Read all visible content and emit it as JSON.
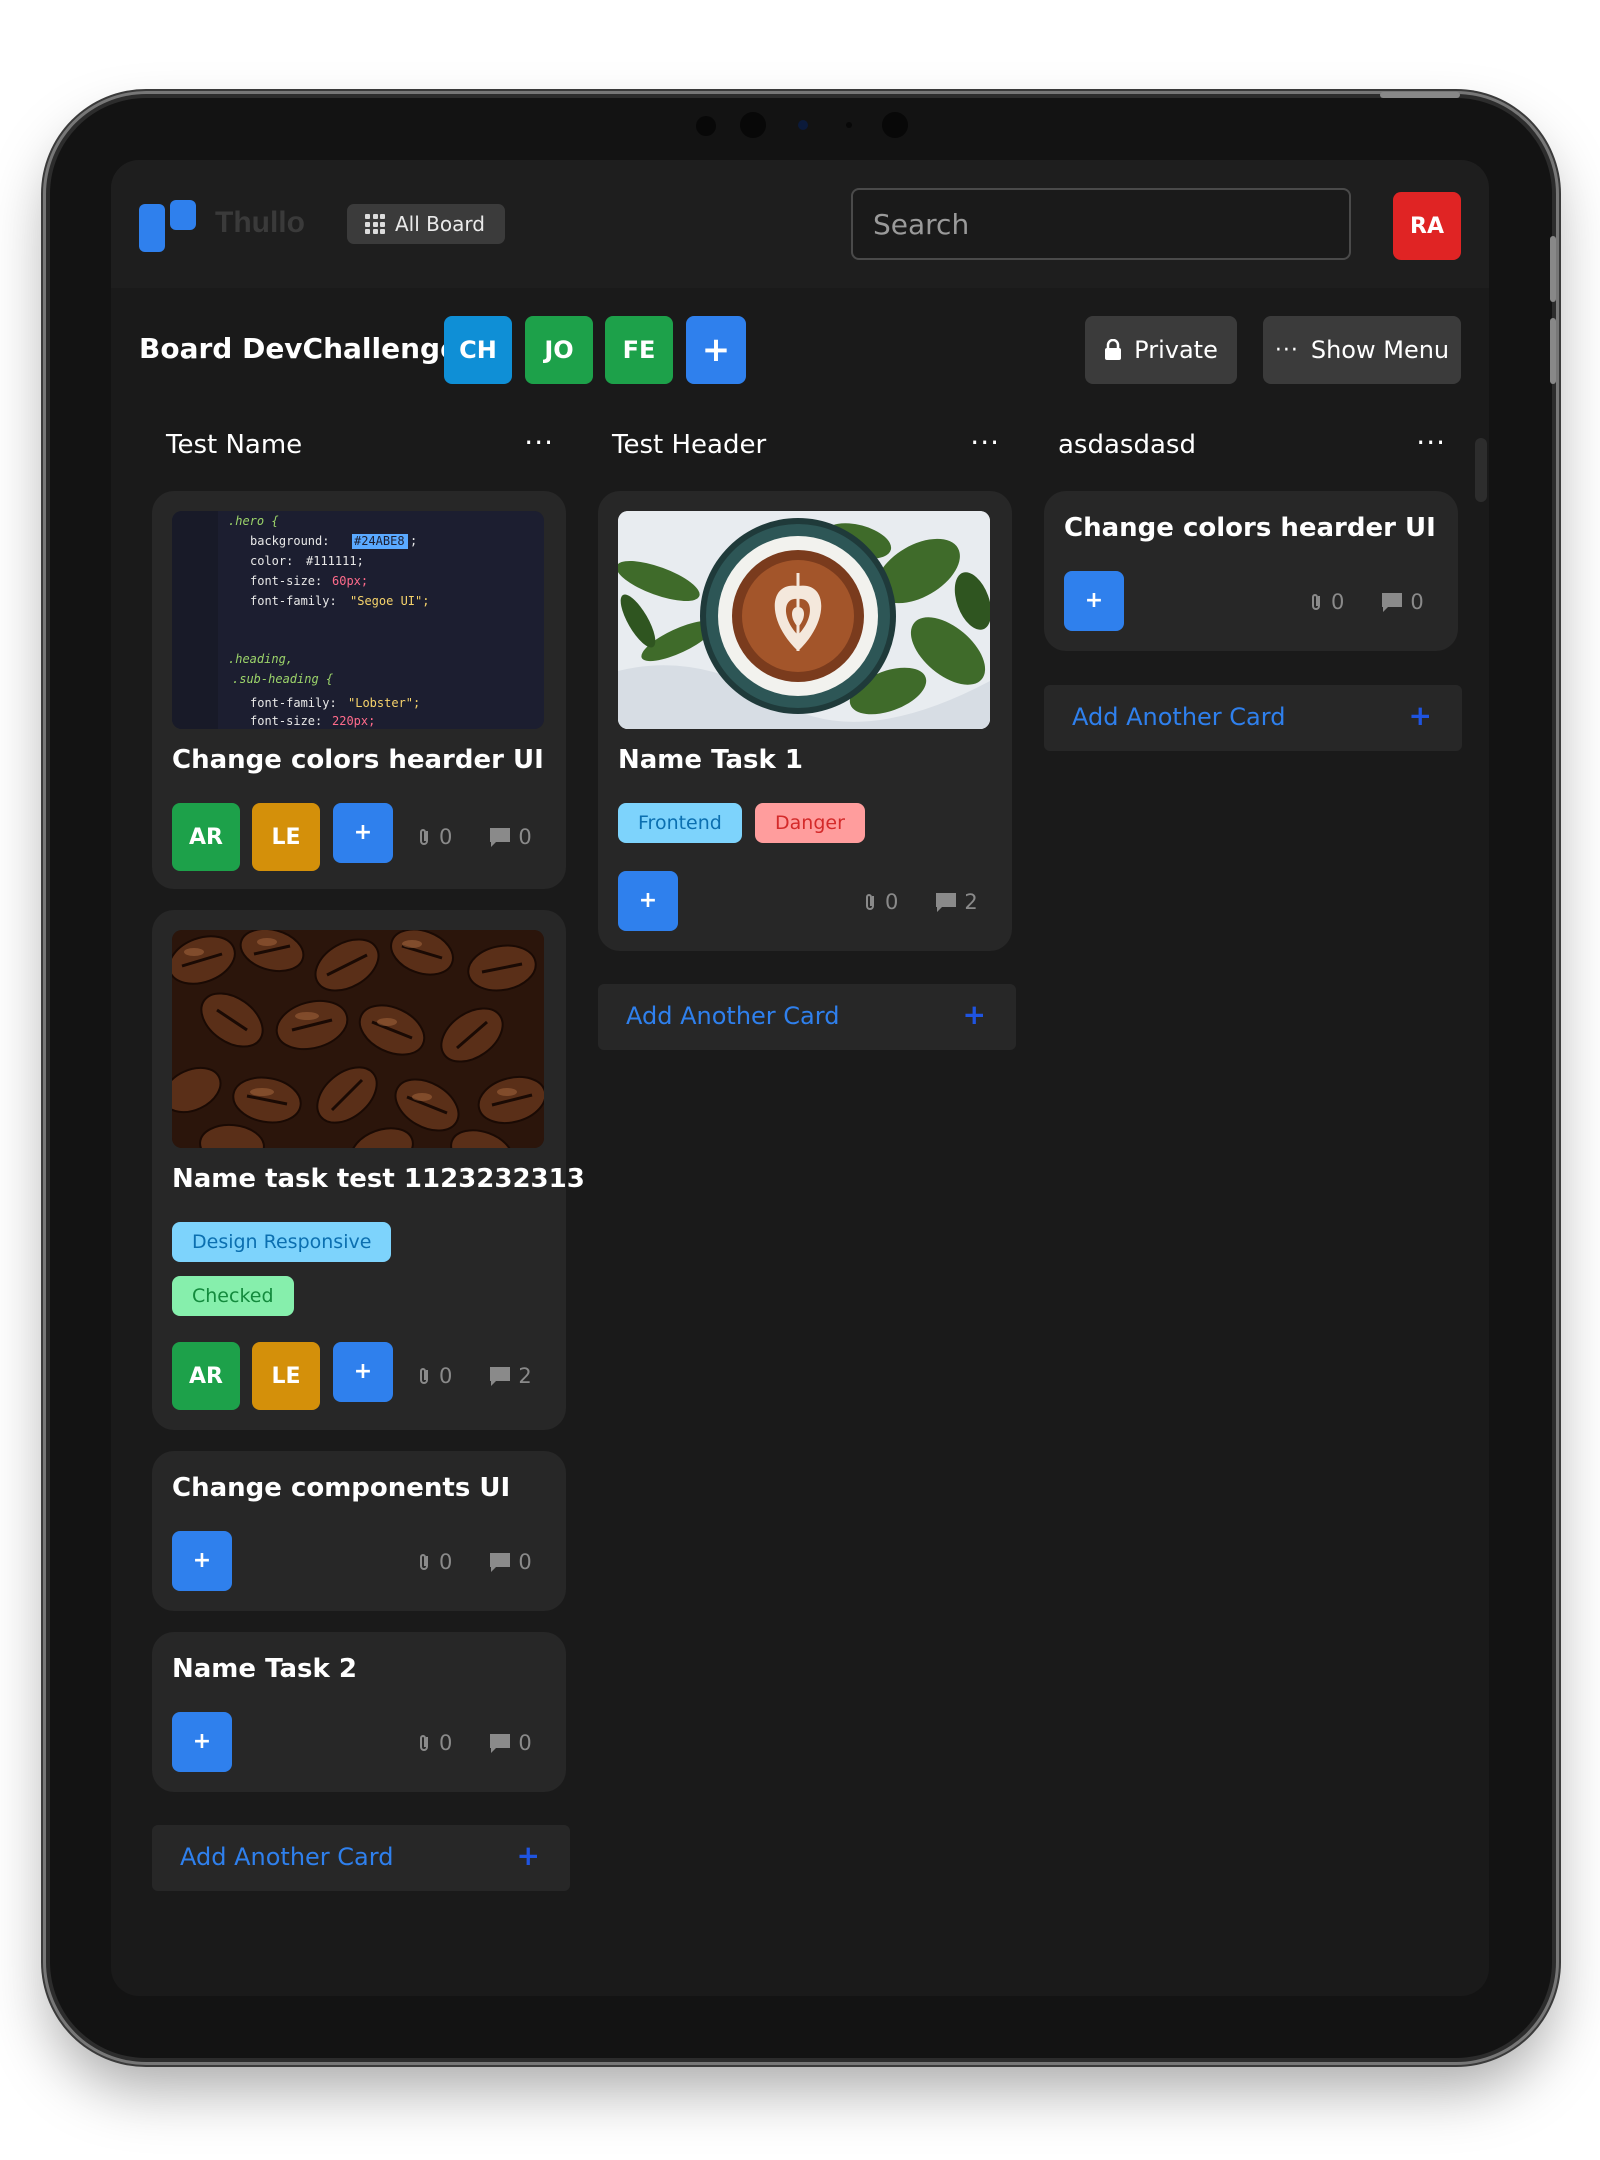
{
  "app": {
    "brand": "Thullo",
    "all_board_label": "All Board",
    "search_placeholder": "Search",
    "user_initials": "RA"
  },
  "board": {
    "title": "Board DevChallenge",
    "members": [
      {
        "initials": "CH",
        "color": "#0f8fd6"
      },
      {
        "initials": "JO",
        "color": "#1da14a"
      },
      {
        "initials": "FE",
        "color": "#1da14a"
      }
    ],
    "private_label": "Private",
    "show_menu_label": "Show Menu"
  },
  "colors": {
    "accent": "#2f80ed",
    "card": "#272727",
    "danger_tag_bg": "#ff9d9d",
    "frontend_tag_bg": "#7dd3fc",
    "checked_tag_bg": "#86efac"
  },
  "add_card_label": "Add Another Card",
  "columns": [
    {
      "title": "Test Name",
      "cards": [
        {
          "title": "Change colors hearder UI",
          "image": "code-snippet",
          "members": [
            "AR",
            "LE"
          ],
          "attachments": "0",
          "comments": "0",
          "code_lines": [
            ".hero {",
            "background: ",
            "#24ABE8",
            ";",
            "color: ",
            "#111111;",
            "font-size: ",
            "60px;",
            "font-family: ",
            "\"Segoe UI\";",
            ".heading,",
            ".sub-heading {",
            "font-family: ",
            "\"Lobster\";",
            "font-size: ",
            "220px;"
          ]
        },
        {
          "title": "Name task test 1123232313",
          "image": "coffee-beans",
          "labels": [
            "Design Responsive",
            "Checked"
          ],
          "members": [
            "AR",
            "LE"
          ],
          "attachments": "0",
          "comments": "2"
        },
        {
          "title": "Change components UI",
          "attachments": "0",
          "comments": "0"
        },
        {
          "title": "Name Task 2",
          "attachments": "0",
          "comments": "0"
        }
      ]
    },
    {
      "title": "Test Header",
      "cards": [
        {
          "title": "Name Task 1",
          "image": "latte-art-cup",
          "labels": [
            "Frontend",
            "Danger"
          ],
          "attachments": "0",
          "comments": "2"
        }
      ]
    },
    {
      "title": "asdasdasd",
      "cards": [
        {
          "title": "Change colors hearder UI",
          "attachments": "0",
          "comments": "0"
        }
      ]
    }
  ]
}
